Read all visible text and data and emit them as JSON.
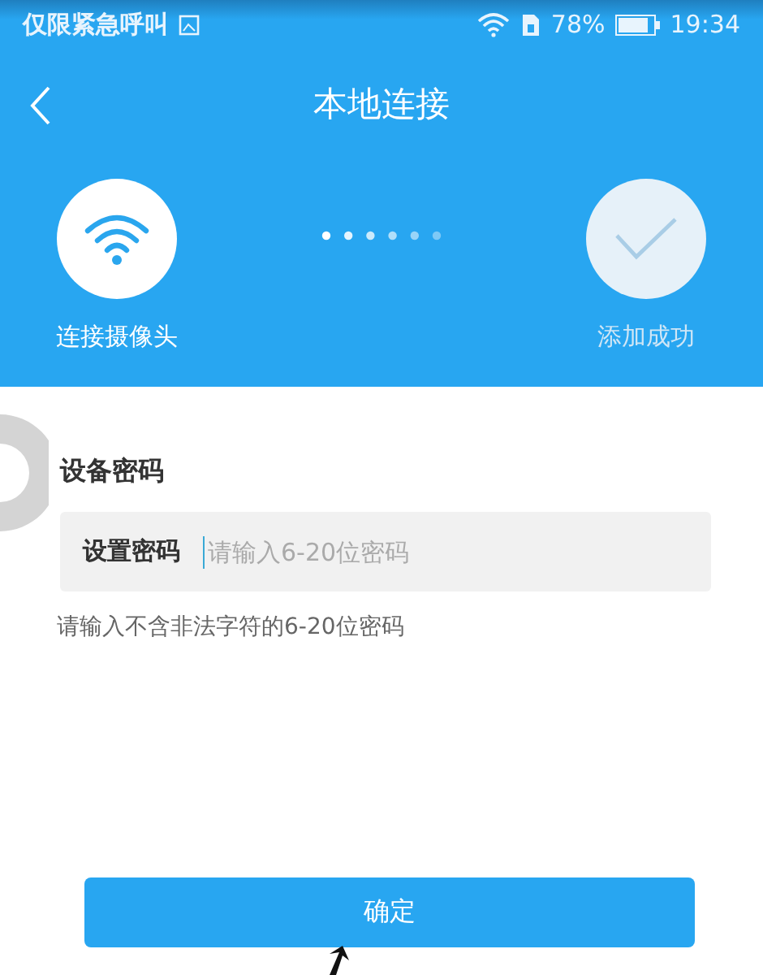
{
  "status_bar": {
    "carrier": "仅限紧急呼叫",
    "battery": "78%",
    "time": "19:34"
  },
  "header": {
    "title": "本地连接"
  },
  "steps": [
    {
      "kind": "wifi",
      "label": "连接摄像头",
      "active": true
    },
    {
      "kind": "check",
      "label": "添加成功",
      "active": false
    }
  ],
  "section": {
    "heading": "设备密码"
  },
  "password_field": {
    "label": "设置密码",
    "placeholder": "请输入6-20位密码"
  },
  "hint": "请输入不含非法字符的6-20位密码",
  "confirm_button": "确定"
}
